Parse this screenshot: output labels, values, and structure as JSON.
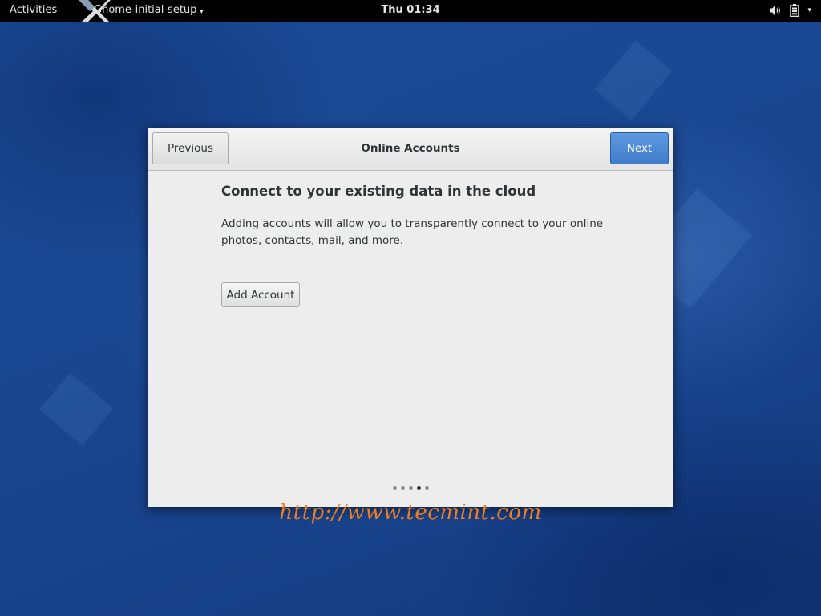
{
  "topbar": {
    "activities_label": "Activities",
    "app_name": "Gnome-initial-setup",
    "app_menu_caret": "▾",
    "clock": "Thu 01:34",
    "status_caret": "▾",
    "icons": [
      "app-logo-icon",
      "volume-icon",
      "battery-icon",
      "chevron-down-icon"
    ]
  },
  "window": {
    "title": "Online Accounts",
    "previous_label": "Previous",
    "next_label": "Next",
    "heading": "Connect to your existing data in the cloud",
    "description": "Adding accounts will allow you to transparently connect to your online photos, contacts, mail, and more.",
    "add_account_label": "Add Account",
    "pager": {
      "total_pages": 5,
      "current_page": 4
    }
  },
  "watermark": "http://www.tecmint.com",
  "colors": {
    "accent": "#4a86d4",
    "topbar": "#000000",
    "desktop": "#1b4a93",
    "watermark": "#f07d1e"
  }
}
